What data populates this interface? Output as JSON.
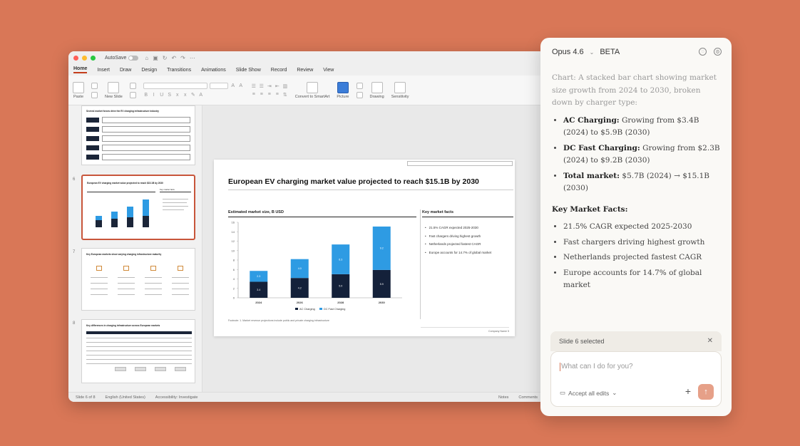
{
  "ppt": {
    "autosave_label": "AutoSave",
    "tabs": [
      "Home",
      "Insert",
      "Draw",
      "Design",
      "Transitions",
      "Animations",
      "Slide Show",
      "Record",
      "Review",
      "View"
    ],
    "ribbon": {
      "paste": "Paste",
      "new_slide": "New Slide",
      "convert_smartart": "Convert to SmartArt",
      "picture": "Picture",
      "drawing": "Drawing",
      "sensitivity": "Sensitivity"
    },
    "thumbnails": {
      "n6": "6",
      "n7": "7",
      "n8": "8",
      "title5": "Several market forces drive the EV charging infrastructure industry",
      "title6": "European EV charging market value projected to reach $15.1B by 2030",
      "title7": "Key European markets show varying charging infrastructure maturity",
      "title8": "Key differences in charging infrastructure across European markets",
      "facts6": "Key market facts"
    },
    "slide": {
      "title": "European EV charging market value projected to reach $15.1B by 2030",
      "chart_subtitle": "Estimated market size, B USD",
      "facts_title": "Key market facts",
      "facts": [
        "21.5% CAGR expected 2025-2030",
        "Fast chargers driving highest growth",
        "Netherlands projected fastest CAGR",
        "Europe accounts for 14.7% of global market"
      ],
      "footnote": "Footnote: 1. Market revenue projections include public and private charging infrastructure",
      "footer": "Company Name   5"
    },
    "status": {
      "slide": "Slide 6 of 8",
      "language": "English (United States)",
      "accessibility": "Accessibility: Investigate",
      "notes": "Notes",
      "comments": "Comments"
    }
  },
  "chart_data": {
    "type": "bar",
    "stacked": true,
    "categories": [
      "2024",
      "2026",
      "2028",
      "2030"
    ],
    "series": [
      {
        "name": "AC Charging",
        "values": [
          3.4,
          4.2,
          5.0,
          5.9
        ],
        "color": "#14213a"
      },
      {
        "name": "DC Fast Charging",
        "values": [
          2.3,
          4.0,
          6.3,
          9.2
        ],
        "color": "#2e9be3"
      }
    ],
    "ylim": [
      0,
      16
    ],
    "yticks": [
      "0",
      "2",
      "4",
      "6",
      "8",
      "10",
      "12",
      "14",
      "16"
    ]
  },
  "panel": {
    "model": "Opus 4.6",
    "beta": "BETA",
    "chart_label": "Chart:",
    "chart_desc": " A stacked bar chart showing market size growth from 2024 to 2030, broken down by charger type:",
    "bullets": [
      {
        "bold": "AC Charging:",
        "text": " Growing from $3.4B (2024) to $5.9B (2030)"
      },
      {
        "bold": "DC Fast Charging:",
        "text": " Growing from $2.3B (2024) to $9.2B (2030)"
      },
      {
        "bold": "Total market:",
        "text": " $5.7B (2024) → $15.1B (2030)"
      }
    ],
    "facts_heading": "Key Market Facts:",
    "facts": [
      "21.5% CAGR expected 2025-2030",
      "Fast chargers driving highest growth",
      "Netherlands projected fastest CAGR",
      "Europe accounts for 14.7% of global market"
    ],
    "selected_chip": "Slide 6 selected",
    "input_placeholder": "What can I do for you?",
    "accept_edits": "Accept all edits"
  },
  "colors": {
    "background": "#d97757",
    "accent": "#c43e1c",
    "ac": "#14213a",
    "dc": "#2e9be3"
  }
}
